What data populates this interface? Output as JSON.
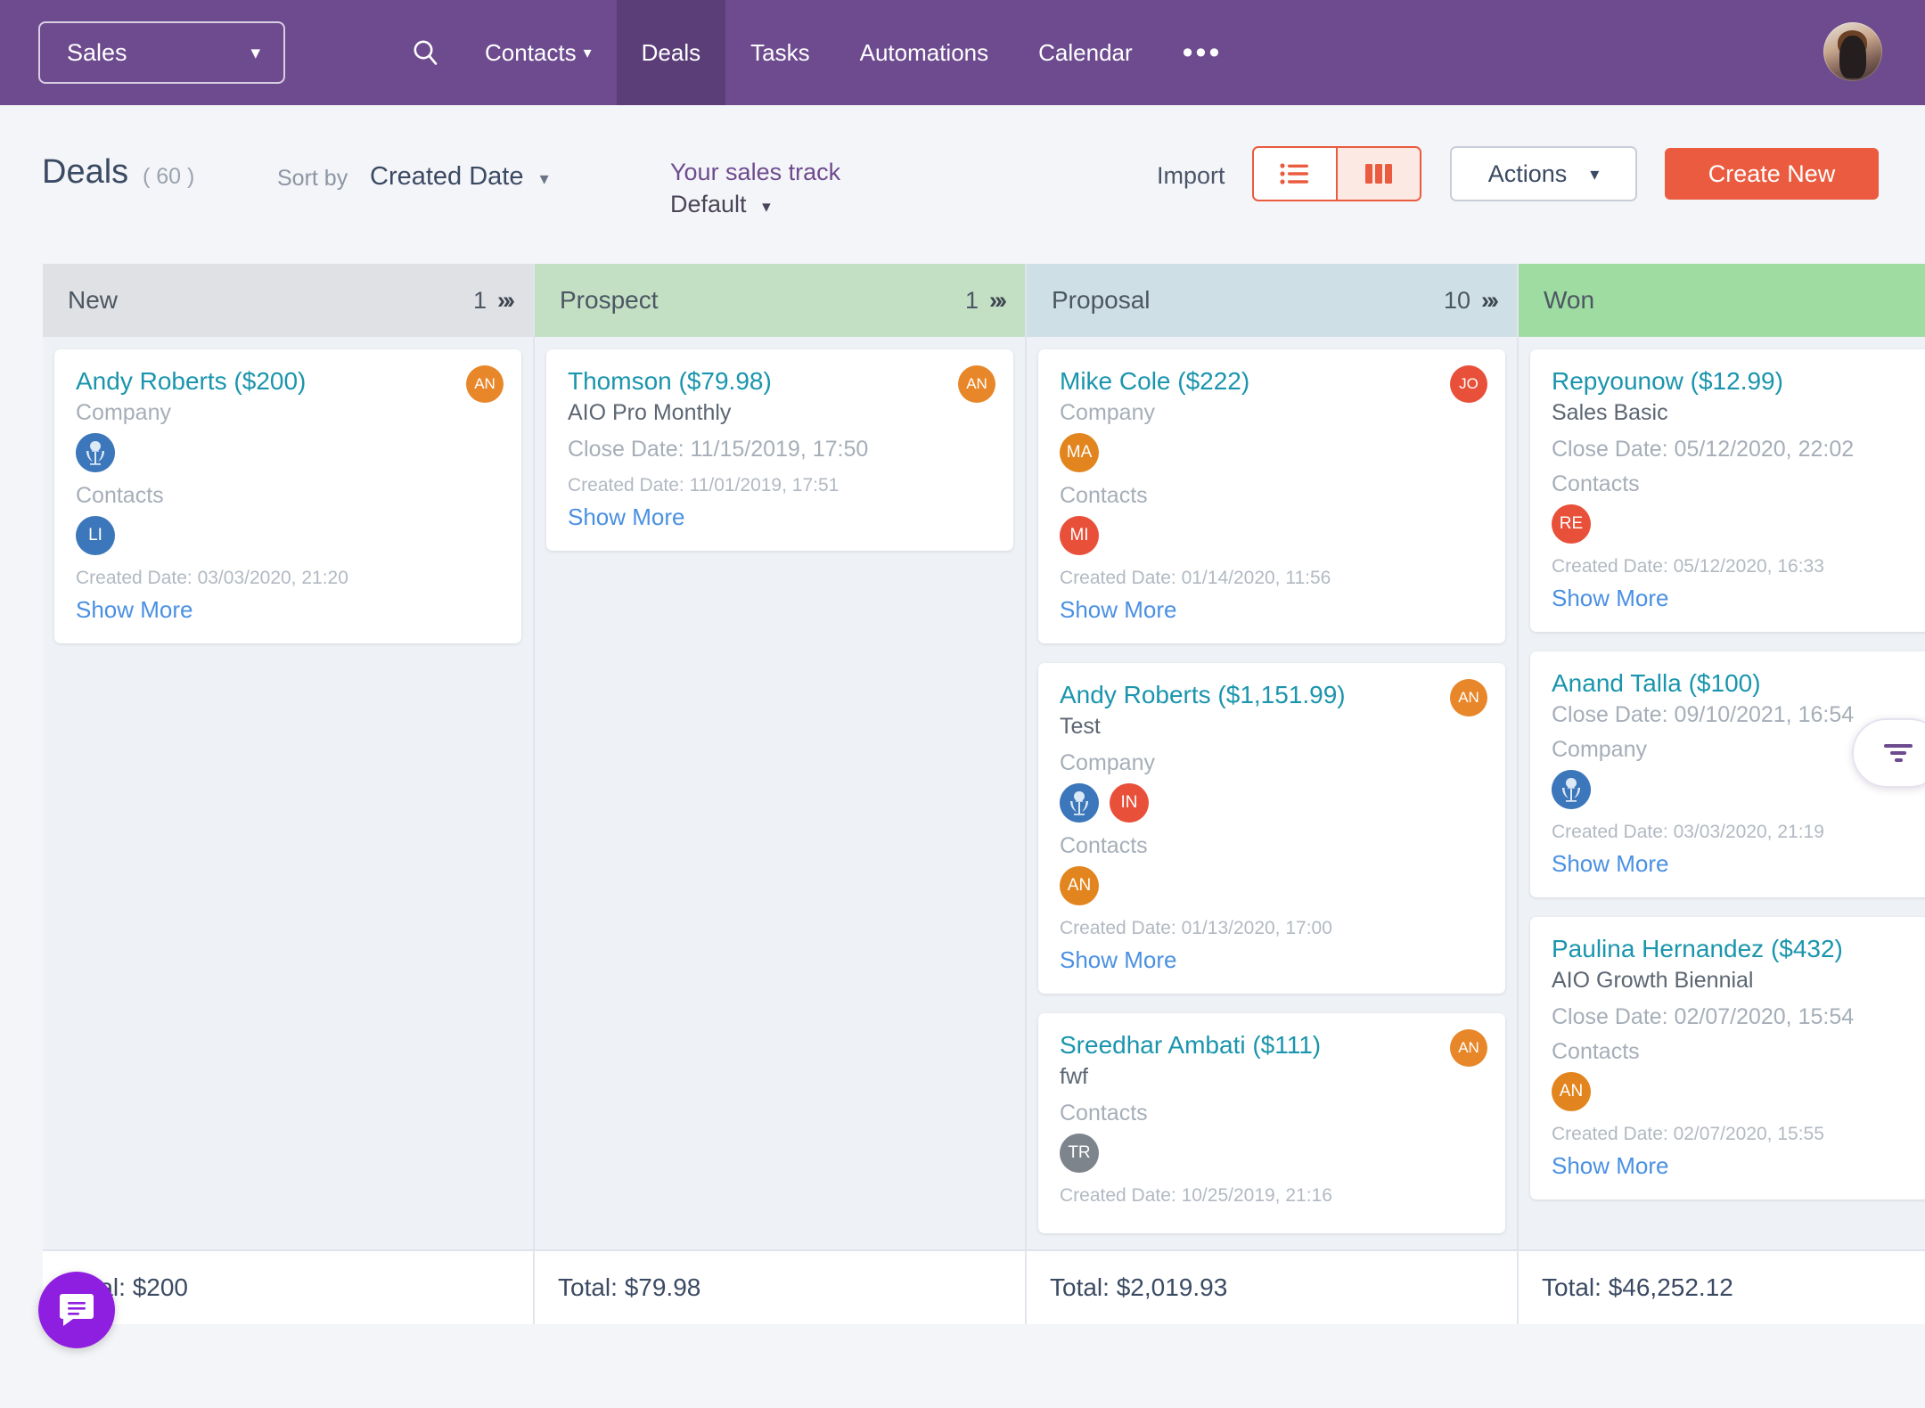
{
  "nav": {
    "app_switcher": "Sales",
    "app_switcher_caret": "chevron-down-icon",
    "search_icon": "search-icon",
    "items": [
      {
        "label": "Contacts",
        "has_caret": true,
        "active": false
      },
      {
        "label": "Deals",
        "has_caret": false,
        "active": true
      },
      {
        "label": "Tasks",
        "has_caret": false,
        "active": false
      },
      {
        "label": "Automations",
        "has_caret": false,
        "active": false
      },
      {
        "label": "Calendar",
        "has_caret": false,
        "active": false
      }
    ],
    "more_label": "•••",
    "avatar": "user-avatar",
    "bg_color": "#6d4b8e",
    "active_tab_color": "#5b3d78"
  },
  "toolbar": {
    "title": "Deals",
    "count": "( 60 )",
    "sort_by_label": "Sort by",
    "sort_by_value": "Created Date",
    "track_label": "Your sales track",
    "track_value": "Default",
    "import_label": "Import",
    "view_list_icon": "list-view-icon",
    "view_board_icon": "board-view-icon",
    "active_view": "board",
    "actions_label": "Actions",
    "create_label": "Create New",
    "accent_color": "#ea5b3f",
    "purple_color": "#6d4b8e"
  },
  "board": {
    "columns": [
      {
        "name": "New",
        "count": "1",
        "header_color": "#dfe1e5",
        "total": "Total: $200",
        "cards": [
          {
            "title": "Andy Roberts ($200)",
            "subtitle": null,
            "close_date": null,
            "company_label": "Company",
            "company_avatars": [
              {
                "type": "logo",
                "initials": "",
                "color": "#3d77bb"
              }
            ],
            "contacts_label": "Contacts",
            "contact_avatars": [
              {
                "type": "initials",
                "initials": "LI",
                "color": "#3d77bb"
              }
            ],
            "created": "Created Date: 03/03/2020, 21:20",
            "show_more": "Show More",
            "owner": {
              "initials": "AN",
              "color": "#e8872a"
            }
          }
        ]
      },
      {
        "name": "Prospect",
        "count": "1",
        "header_color": "#c3dfc4",
        "total": "Total: $79.98",
        "cards": [
          {
            "title": "Thomson ($79.98)",
            "subtitle": "AIO Pro Monthly",
            "close_date": "Close Date: 11/15/2019, 17:50",
            "company_label": null,
            "company_avatars": [],
            "contacts_label": null,
            "contact_avatars": [],
            "created": "Created Date: 11/01/2019, 17:51",
            "show_more": "Show More",
            "owner": {
              "initials": "AN",
              "color": "#e8872a"
            }
          }
        ]
      },
      {
        "name": "Proposal",
        "count": "10",
        "header_color": "#cfdfe6",
        "total": "Total: $2,019.93",
        "cards": [
          {
            "title": "Mike Cole ($222)",
            "subtitle": null,
            "close_date": null,
            "company_label": "Company",
            "company_avatars": [
              {
                "type": "initials",
                "initials": "MA",
                "color": "#e2851e"
              }
            ],
            "contacts_label": "Contacts",
            "contact_avatars": [
              {
                "type": "initials",
                "initials": "MI",
                "color": "#e8503a"
              }
            ],
            "created": "Created Date: 01/14/2020, 11:56",
            "show_more": "Show More",
            "owner": {
              "initials": "JO",
              "color": "#e8503a"
            }
          },
          {
            "title": "Andy Roberts ($1,151.99)",
            "subtitle": "Test",
            "close_date": null,
            "company_label": "Company",
            "company_avatars": [
              {
                "type": "logo",
                "initials": "",
                "color": "#3d77bb"
              },
              {
                "type": "initials",
                "initials": "IN",
                "color": "#e8503a"
              }
            ],
            "contacts_label": "Contacts",
            "contact_avatars": [
              {
                "type": "initials",
                "initials": "AN",
                "color": "#e2851e"
              }
            ],
            "created": "Created Date: 01/13/2020, 17:00",
            "show_more": "Show More",
            "owner": {
              "initials": "AN",
              "color": "#e8872a"
            }
          },
          {
            "title": "Sreedhar Ambati ($111)",
            "subtitle": "fwf",
            "close_date": null,
            "company_label": null,
            "company_avatars": [],
            "contacts_label": "Contacts",
            "contact_avatars": [
              {
                "type": "initials",
                "initials": "TR",
                "color": "#7d848c"
              }
            ],
            "created": "Created Date: 10/25/2019, 21:16",
            "show_more": null,
            "owner": {
              "initials": "AN",
              "color": "#e8872a"
            }
          }
        ]
      },
      {
        "name": "Won",
        "count": "",
        "header_color": "#9edca2",
        "total": "Total: $46,252.12",
        "cards": [
          {
            "title": "Repyounow ($12.99)",
            "subtitle": "Sales Basic",
            "close_date": "Close Date: 05/12/2020, 22:02",
            "company_label": null,
            "company_avatars": [],
            "contacts_label": "Contacts",
            "contact_avatars": [
              {
                "type": "initials",
                "initials": "RE",
                "color": "#e8503a"
              }
            ],
            "created": "Created Date: 05/12/2020, 16:33",
            "show_more": "Show More",
            "owner": null
          },
          {
            "title": "Anand Talla ($100)",
            "subtitle": null,
            "close_date": "Close Date: 09/10/2021, 16:54",
            "company_label": "Company",
            "company_avatars": [
              {
                "type": "logo",
                "initials": "",
                "color": "#3d77bb"
              }
            ],
            "contacts_label": null,
            "contact_avatars": [],
            "created": "Created Date: 03/03/2020, 21:19",
            "show_more": "Show More",
            "owner": null
          },
          {
            "title": "Paulina Hernandez ($432)",
            "subtitle": "AIO Growth Biennial",
            "close_date": "Close Date: 02/07/2020, 15:54",
            "company_label": null,
            "company_avatars": [],
            "contacts_label": "Contacts",
            "contact_avatars": [
              {
                "type": "initials",
                "initials": "AN",
                "color": "#e2851e"
              }
            ],
            "created": "Created Date: 02/07/2020, 15:55",
            "show_more": "Show More",
            "owner": null
          }
        ]
      }
    ]
  },
  "floating": {
    "chat_icon": "chat-bubble-icon",
    "chat_color": "#8f1fe0",
    "filter_icon": "filter-funnel-icon",
    "filter_color": "#6d4b8e"
  }
}
